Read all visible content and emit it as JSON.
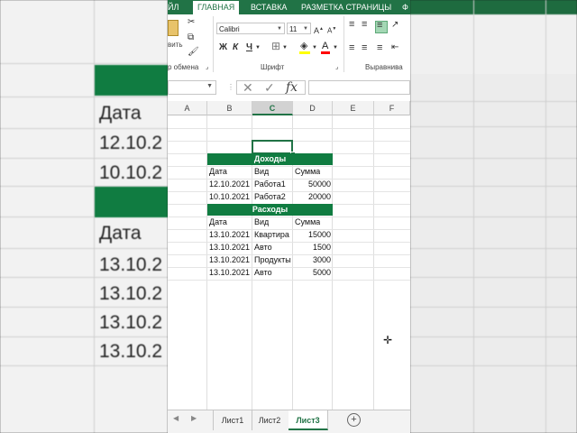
{
  "ribbon_tabs": [
    {
      "label": "ЙЛ",
      "active": false
    },
    {
      "label": "ГЛАВНАЯ",
      "active": true
    },
    {
      "label": "ВСТАВКА",
      "active": false
    },
    {
      "label": "РАЗМЕТКА СТРАНИЦЫ",
      "active": false
    },
    {
      "label": "Ф",
      "active": false
    }
  ],
  "ribbon": {
    "paste_label": "вить",
    "clipboard_group": "р обмена",
    "font_name": "Calibri",
    "font_size": "11",
    "bold": "Ж",
    "italic": "К",
    "underline": "Ч",
    "font_group": "Шрифт",
    "align_group": "Выравнива"
  },
  "formula_bar": {
    "name_box": "",
    "cancel": "✕",
    "enter": "✓",
    "fx": "fx",
    "content": ""
  },
  "columns": [
    "A",
    "B",
    "C",
    "D",
    "E",
    "F"
  ],
  "selected_column": "C",
  "income": {
    "title": "Доходы",
    "headers": [
      "Дата",
      "Вид",
      "Сумма"
    ],
    "rows": [
      [
        "12.10.2021",
        "Работа1",
        "50000"
      ],
      [
        "10.10.2021",
        "Работа2",
        "20000"
      ]
    ]
  },
  "expenses": {
    "title": "Расходы",
    "headers": [
      "Дата",
      "Вид",
      "Сумма"
    ],
    "rows": [
      [
        "13.10.2021",
        "Квартира",
        "15000"
      ],
      [
        "13.10.2021",
        "Авто",
        "1500"
      ],
      [
        "13.10.2021",
        "Продукты",
        "3000"
      ],
      [
        "13.10.2021",
        "Авто",
        "5000"
      ]
    ]
  },
  "sheets": [
    {
      "label": "Лист1",
      "active": false
    },
    {
      "label": "Лист2",
      "active": false
    },
    {
      "label": "Лист3",
      "active": true
    }
  ],
  "background_left": {
    "header": "Дата",
    "dates_a": [
      "12.10.2",
      "10.10.2"
    ],
    "header2": "Дата",
    "dates_b": [
      "13.10.2",
      "13.10.2",
      "13.10.2",
      "13.10.2"
    ]
  },
  "colors": {
    "accent": "#217346",
    "header_band": "#107c41"
  }
}
